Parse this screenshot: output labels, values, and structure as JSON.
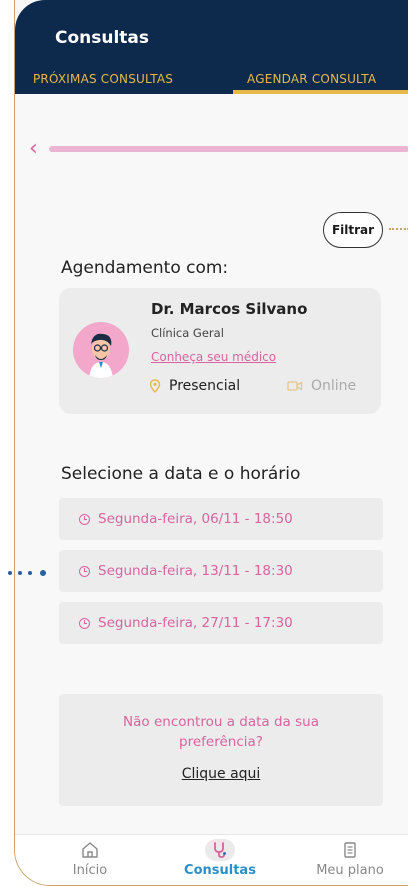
{
  "appbar": {
    "title": "Consultas"
  },
  "tabs": [
    {
      "label": "PRÓXIMAS CONSULTAS",
      "active": false
    },
    {
      "label": "AGENDAR CONSULTA",
      "active": true
    }
  ],
  "filter": {
    "label": "Filtrar"
  },
  "doctor": {
    "heading": "Agendamento com:",
    "name": "Dr. Marcos Silvano",
    "specialty": "Clínica Geral",
    "link": "Conheça seu médico",
    "modes": [
      {
        "label": "Presencial",
        "icon": "location-pin-icon",
        "selected": true
      },
      {
        "label": "Online",
        "icon": "video-camera-icon",
        "selected": false
      }
    ]
  },
  "schedule": {
    "heading": "Selecione a data e o horário",
    "slots": [
      {
        "label": "Segunda-feira, 06/11 - 18:50"
      },
      {
        "label": "Segunda-feira, 13/11 - 18:30"
      },
      {
        "label": "Segunda-feira, 27/11 - 17:30"
      }
    ]
  },
  "notfound": {
    "text": "Não encontrou a data da sua preferência?",
    "link": "Clique aqui"
  },
  "bottomnav": [
    {
      "label": "Início",
      "icon": "home-icon",
      "active": false
    },
    {
      "label": "Consultas",
      "icon": "stethoscope-icon",
      "active": true
    },
    {
      "label": "Meu plano",
      "icon": "document-icon",
      "active": false
    }
  ],
  "colors": {
    "appbar": "#0d2a4d",
    "accent_gold": "#e8b84a",
    "accent_pink": "#d9639e",
    "nav_active": "#2a8ec8"
  }
}
